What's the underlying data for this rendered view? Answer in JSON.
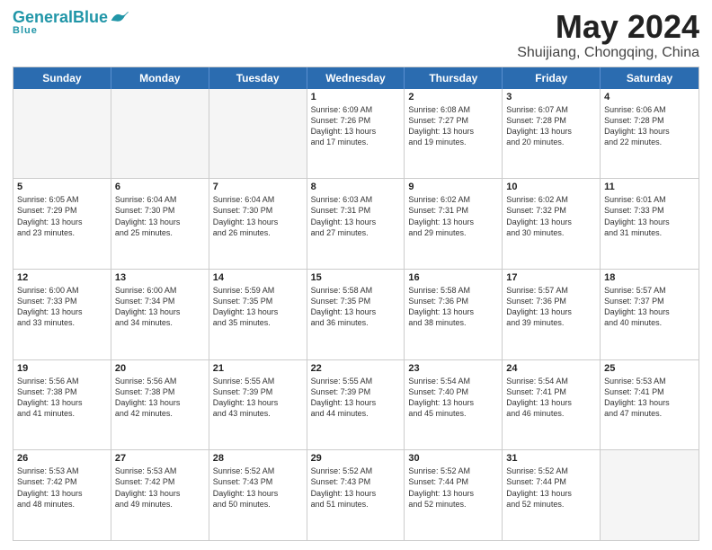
{
  "header": {
    "logo_general": "General",
    "logo_blue": "Blue",
    "month": "May 2024",
    "location": "Shuijiang, Chongqing, China"
  },
  "weekdays": [
    "Sunday",
    "Monday",
    "Tuesday",
    "Wednesday",
    "Thursday",
    "Friday",
    "Saturday"
  ],
  "rows": [
    [
      {
        "day": "",
        "text": "",
        "empty": true
      },
      {
        "day": "",
        "text": "",
        "empty": true
      },
      {
        "day": "",
        "text": "",
        "empty": true
      },
      {
        "day": "1",
        "text": "Sunrise: 6:09 AM\nSunset: 7:26 PM\nDaylight: 13 hours\nand 17 minutes."
      },
      {
        "day": "2",
        "text": "Sunrise: 6:08 AM\nSunset: 7:27 PM\nDaylight: 13 hours\nand 19 minutes."
      },
      {
        "day": "3",
        "text": "Sunrise: 6:07 AM\nSunset: 7:28 PM\nDaylight: 13 hours\nand 20 minutes."
      },
      {
        "day": "4",
        "text": "Sunrise: 6:06 AM\nSunset: 7:28 PM\nDaylight: 13 hours\nand 22 minutes."
      }
    ],
    [
      {
        "day": "5",
        "text": "Sunrise: 6:05 AM\nSunset: 7:29 PM\nDaylight: 13 hours\nand 23 minutes."
      },
      {
        "day": "6",
        "text": "Sunrise: 6:04 AM\nSunset: 7:30 PM\nDaylight: 13 hours\nand 25 minutes."
      },
      {
        "day": "7",
        "text": "Sunrise: 6:04 AM\nSunset: 7:30 PM\nDaylight: 13 hours\nand 26 minutes."
      },
      {
        "day": "8",
        "text": "Sunrise: 6:03 AM\nSunset: 7:31 PM\nDaylight: 13 hours\nand 27 minutes."
      },
      {
        "day": "9",
        "text": "Sunrise: 6:02 AM\nSunset: 7:31 PM\nDaylight: 13 hours\nand 29 minutes."
      },
      {
        "day": "10",
        "text": "Sunrise: 6:02 AM\nSunset: 7:32 PM\nDaylight: 13 hours\nand 30 minutes."
      },
      {
        "day": "11",
        "text": "Sunrise: 6:01 AM\nSunset: 7:33 PM\nDaylight: 13 hours\nand 31 minutes."
      }
    ],
    [
      {
        "day": "12",
        "text": "Sunrise: 6:00 AM\nSunset: 7:33 PM\nDaylight: 13 hours\nand 33 minutes."
      },
      {
        "day": "13",
        "text": "Sunrise: 6:00 AM\nSunset: 7:34 PM\nDaylight: 13 hours\nand 34 minutes."
      },
      {
        "day": "14",
        "text": "Sunrise: 5:59 AM\nSunset: 7:35 PM\nDaylight: 13 hours\nand 35 minutes."
      },
      {
        "day": "15",
        "text": "Sunrise: 5:58 AM\nSunset: 7:35 PM\nDaylight: 13 hours\nand 36 minutes."
      },
      {
        "day": "16",
        "text": "Sunrise: 5:58 AM\nSunset: 7:36 PM\nDaylight: 13 hours\nand 38 minutes."
      },
      {
        "day": "17",
        "text": "Sunrise: 5:57 AM\nSunset: 7:36 PM\nDaylight: 13 hours\nand 39 minutes."
      },
      {
        "day": "18",
        "text": "Sunrise: 5:57 AM\nSunset: 7:37 PM\nDaylight: 13 hours\nand 40 minutes."
      }
    ],
    [
      {
        "day": "19",
        "text": "Sunrise: 5:56 AM\nSunset: 7:38 PM\nDaylight: 13 hours\nand 41 minutes."
      },
      {
        "day": "20",
        "text": "Sunrise: 5:56 AM\nSunset: 7:38 PM\nDaylight: 13 hours\nand 42 minutes."
      },
      {
        "day": "21",
        "text": "Sunrise: 5:55 AM\nSunset: 7:39 PM\nDaylight: 13 hours\nand 43 minutes."
      },
      {
        "day": "22",
        "text": "Sunrise: 5:55 AM\nSunset: 7:39 PM\nDaylight: 13 hours\nand 44 minutes."
      },
      {
        "day": "23",
        "text": "Sunrise: 5:54 AM\nSunset: 7:40 PM\nDaylight: 13 hours\nand 45 minutes."
      },
      {
        "day": "24",
        "text": "Sunrise: 5:54 AM\nSunset: 7:41 PM\nDaylight: 13 hours\nand 46 minutes."
      },
      {
        "day": "25",
        "text": "Sunrise: 5:53 AM\nSunset: 7:41 PM\nDaylight: 13 hours\nand 47 minutes."
      }
    ],
    [
      {
        "day": "26",
        "text": "Sunrise: 5:53 AM\nSunset: 7:42 PM\nDaylight: 13 hours\nand 48 minutes."
      },
      {
        "day": "27",
        "text": "Sunrise: 5:53 AM\nSunset: 7:42 PM\nDaylight: 13 hours\nand 49 minutes."
      },
      {
        "day": "28",
        "text": "Sunrise: 5:52 AM\nSunset: 7:43 PM\nDaylight: 13 hours\nand 50 minutes."
      },
      {
        "day": "29",
        "text": "Sunrise: 5:52 AM\nSunset: 7:43 PM\nDaylight: 13 hours\nand 51 minutes."
      },
      {
        "day": "30",
        "text": "Sunrise: 5:52 AM\nSunset: 7:44 PM\nDaylight: 13 hours\nand 52 minutes."
      },
      {
        "day": "31",
        "text": "Sunrise: 5:52 AM\nSunset: 7:44 PM\nDaylight: 13 hours\nand 52 minutes."
      },
      {
        "day": "",
        "text": "",
        "empty": true
      }
    ]
  ]
}
